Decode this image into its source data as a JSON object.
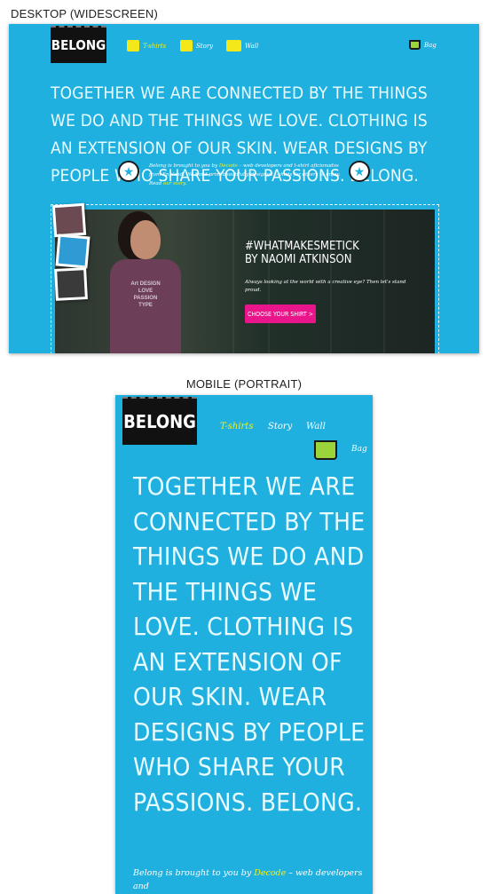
{
  "captions": {
    "desktop": "DESKTOP (WIDESCREEN)",
    "mobile": "MOBILE (PORTRAIT)"
  },
  "brand": {
    "logo": "BELONG"
  },
  "nav": {
    "tshirts": "T-shirts",
    "story": "Story",
    "wall": "Wall",
    "bag": "Bag"
  },
  "headline": "TOGETHER WE ARE CONNECTED BY THE THINGS WE DO AND THE THINGS WE LOVE. CLOTHING IS AN EXTENSION OF OUR SKIN. WEAR DESIGNS BY PEOPLE WHO SHARE YOUR PASSIONS. BELONG.",
  "intro": {
    "prefix": "Belong is brought to you by ",
    "company": "Decode",
    "middle": " – web developers and t-shirt aficionados from England. We hand print beautifully designed t-shirts for others to enjoy. Read ",
    "story_link": "our story",
    "suffix": "."
  },
  "mobile_intro": {
    "prefix": "Belong is brought to you by ",
    "company": "Decode",
    "suffix": " – web developers and"
  },
  "hero": {
    "tag_line1": "#WHATMAKESMETICK",
    "tag_line2": "BY NAOMI ATKINSON",
    "subtitle": "Always looking at the world with a creative eye? Then let's stand proud.",
    "cta": "CHOOSE YOUR SHIRT >",
    "shirt_print": "Art DESIGN LOVE PASSION TYPE"
  },
  "colors": {
    "background": "#1fb0e0",
    "headline": "#e8fbff",
    "accent_yellow": "#f5f013",
    "cta_pink": "#e8168a",
    "logo_bg": "#111111"
  },
  "icons": {
    "tshirts": "tshirt-icon",
    "story": "scroll-icon",
    "wall": "camera-icon",
    "bag": "basket-icon",
    "badge": "star-icon"
  }
}
